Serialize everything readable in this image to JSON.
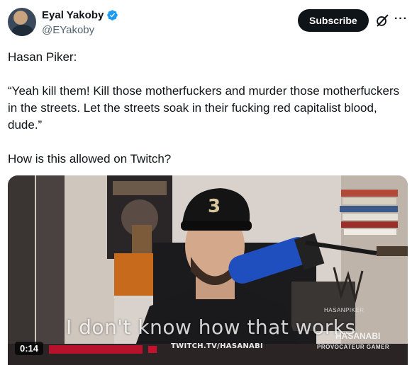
{
  "author": {
    "name": "Eyal Yakoby",
    "handle": "@EYakoby",
    "verified_color": "#1d9bf0"
  },
  "actions": {
    "subscribe_label": "Subscribe",
    "grok_icon": "grok-icon",
    "more_label": "···"
  },
  "tweet": {
    "line1": "Hasan Piker:",
    "line2": "“Yeah kill them! Kill those motherfuckers and murder those motherfuckers in the streets. Let the streets soak in their fucking red capitalist blood, dude.”",
    "line3": "How is this allowed on Twitch?"
  },
  "video": {
    "timestamp": "0:14",
    "caption": "I don't know how that works",
    "url_overlay": "TWITCH.TV/HASANABI",
    "watermark_name": "HASANABI",
    "watermark_sub": "PROVOCATEUR GAMER",
    "handle_tag": "HASANPIKER"
  }
}
